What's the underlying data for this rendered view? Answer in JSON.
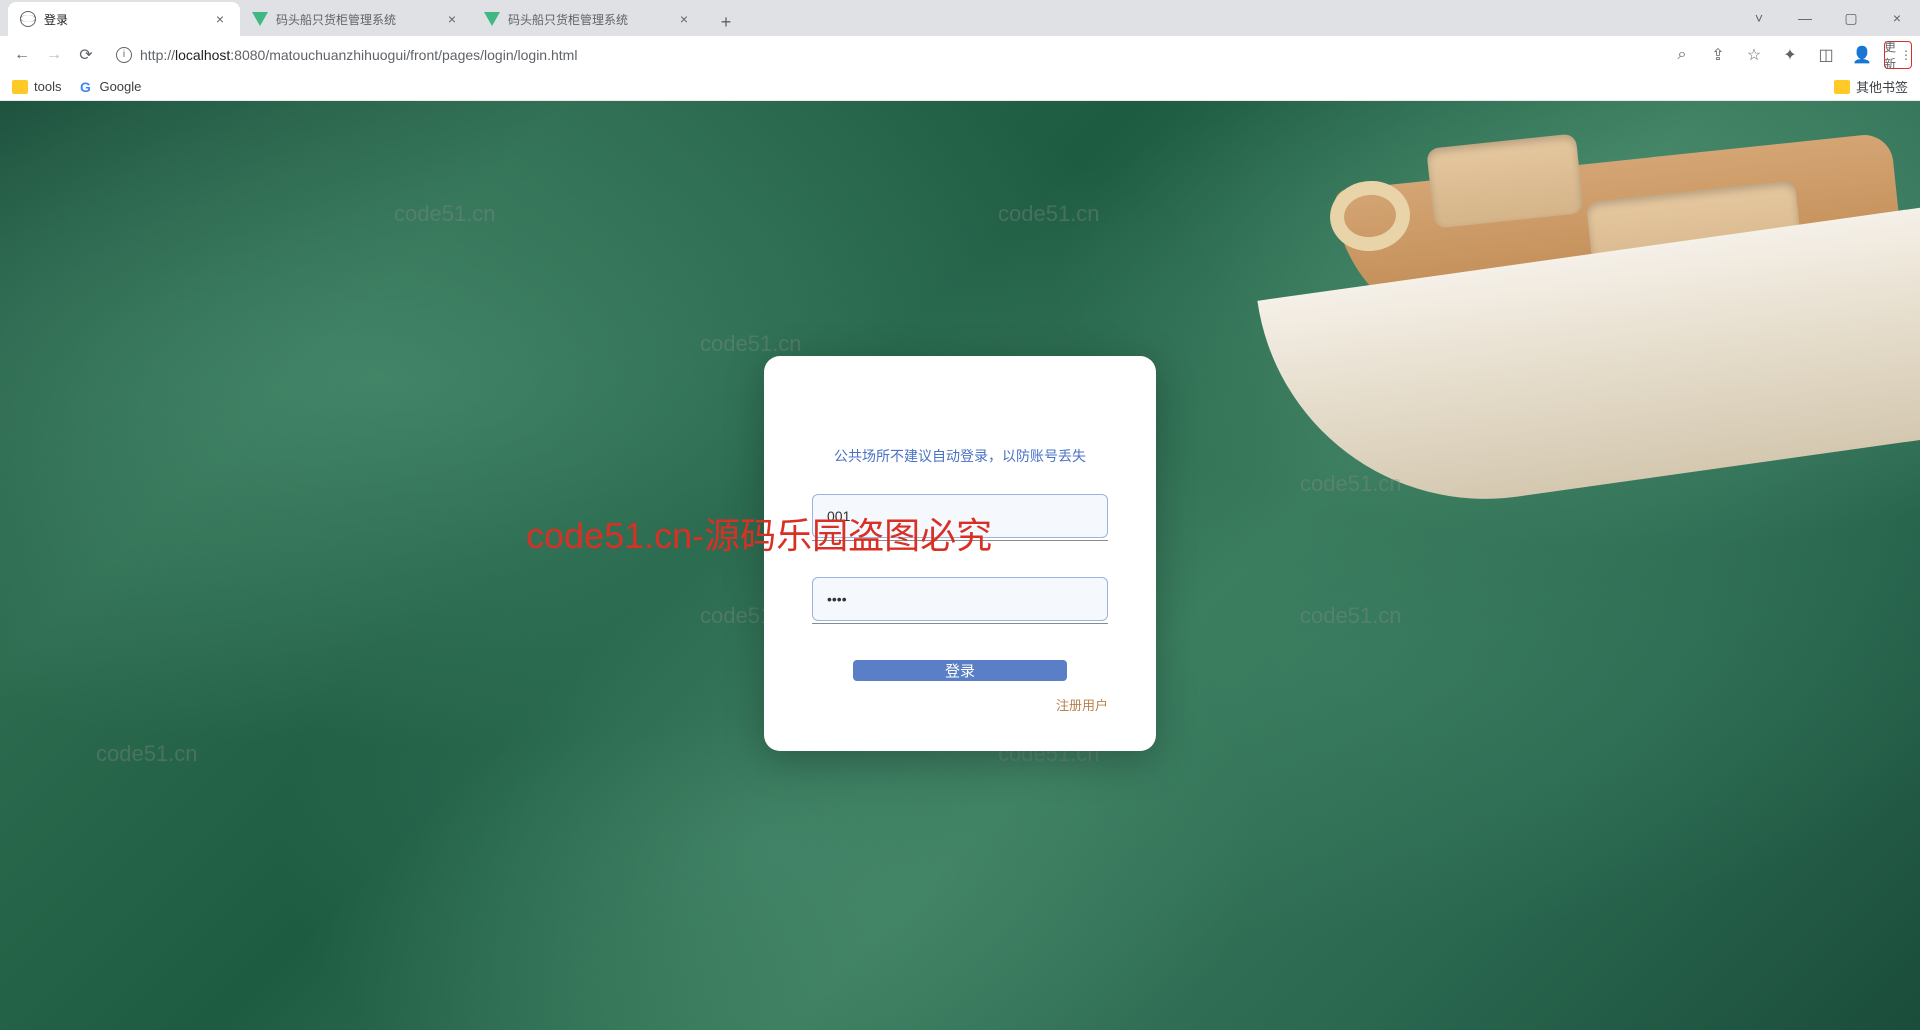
{
  "browser": {
    "tabs": [
      {
        "title": "登录",
        "active": true,
        "icon": "globe"
      },
      {
        "title": "码头船只货柜管理系统",
        "active": false,
        "icon": "vue"
      },
      {
        "title": "码头船只货柜管理系统",
        "active": false,
        "icon": "vue"
      }
    ],
    "url_prefix": "http://",
    "url_host": "localhost",
    "url_path": ":8080/matouchuanzhihuogui/front/pages/login/login.html",
    "update_label": "更新",
    "bookmarks": [
      {
        "label": "tools",
        "icon": "folder"
      },
      {
        "label": "Google",
        "icon": "g"
      }
    ],
    "other_bookmarks_label": "其他书签"
  },
  "login": {
    "tip": "公共场所不建议自动登录，以防账号丢失",
    "username_value": "001",
    "password_value": "••••",
    "submit_label": "登录",
    "register_label": "注册用户"
  },
  "watermarks": {
    "small": "code51.cn",
    "big": "code51.cn-源码乐园盗图必究"
  }
}
